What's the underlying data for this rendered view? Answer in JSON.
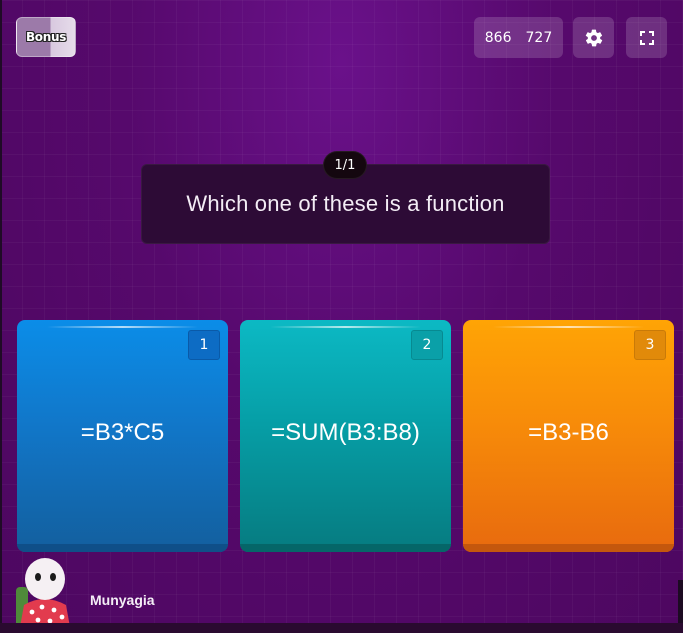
{
  "top_bar": {
    "bonus_label": "Bonus",
    "score_left": "866",
    "score_right": "727",
    "settings_icon": "gear-icon",
    "fullscreen_icon": "fullscreen-icon"
  },
  "question": {
    "counter": "1/1",
    "text": "Which one of these is a function"
  },
  "answers": [
    {
      "number": "1",
      "label": "=B3*C5",
      "color": "#1177c9"
    },
    {
      "number": "2",
      "label": "=SUM(B3:B8)",
      "color": "#069ea6"
    },
    {
      "number": "3",
      "label": "=B3-B6",
      "color": "#f78b09"
    }
  ],
  "player": {
    "name": "Munyagia",
    "avatar_icon": "player-avatar-icon"
  },
  "colors": {
    "background": "#56096c",
    "question_box": "#2d0b36"
  }
}
